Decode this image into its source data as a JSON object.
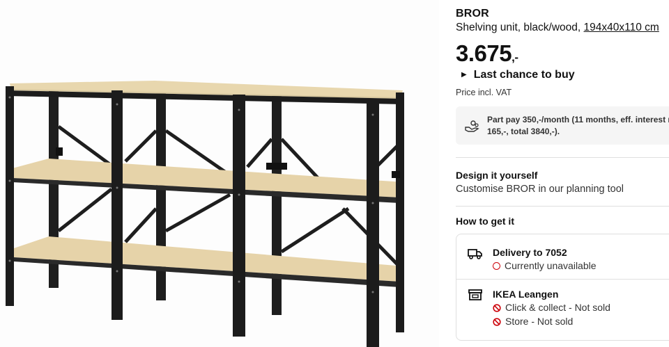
{
  "product": {
    "name": "BROR",
    "description": "Shelving unit, black/wood,",
    "dimensions": "194x40x110 cm",
    "price": "3.675",
    "price_suffix": ",-",
    "last_chance": "Last chance to buy",
    "vat_note": "Price incl. VAT"
  },
  "part_pay": {
    "icon": "hand-coins-icon",
    "line1": "Part pay 350,-/month (11 months, eff. interest r",
    "line2": "165,-, total 3840,-)."
  },
  "design": {
    "title": "Design it yourself",
    "subtitle": "Customise BROR in our planning tool"
  },
  "how_to_get": {
    "title": "How to get it",
    "delivery": {
      "icon": "truck-icon",
      "title": "Delivery to 7052",
      "status": "Currently unavailable"
    },
    "store": {
      "icon": "store-icon",
      "title": "IKEA Leangen",
      "click_collect": "Click & collect - Not sold",
      "store_status": "Store - Not sold"
    }
  },
  "colors": {
    "frame": "#1c1c1c",
    "wood": "#e6d3a9",
    "unavailable": "#cc0008"
  }
}
